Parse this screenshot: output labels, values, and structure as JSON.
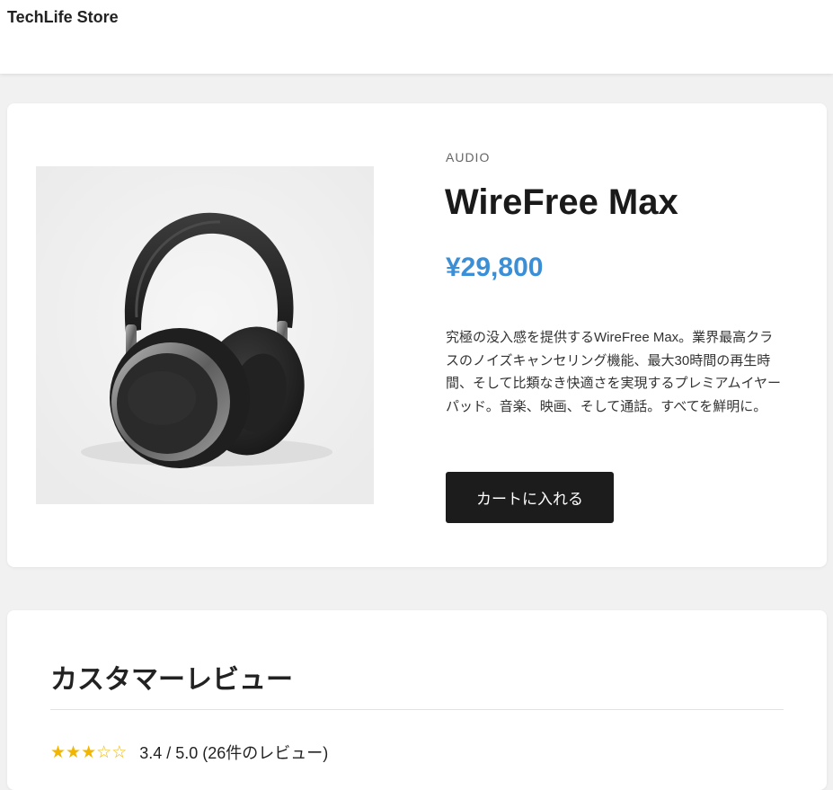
{
  "header": {
    "brand": "TechLife Store"
  },
  "product": {
    "category": "AUDIO",
    "name": "WireFree Max",
    "price": "¥29,800",
    "description": "究極の没入感を提供するWireFree Max。業界最高クラスのノイズキャンセリング機能、最大30時間の再生時間、そして比類なき快適さを実現するプレミアムイヤーパッド。音楽、映画、そして通話。すべてを鮮明に。",
    "cart_button_label": "カートに入れる",
    "image_icon": "headphones-image"
  },
  "reviews": {
    "title": "カスタマーレビュー",
    "rating": 3.4,
    "rating_text": "3.4 / 5.0 (26件のレビュー)",
    "stars": [
      "★",
      "★",
      "★",
      "☆",
      "☆"
    ]
  },
  "colors": {
    "price": "#3a8fd6",
    "button": "#1c1c1c",
    "star": "#f2b600",
    "background": "#f1f1f1"
  }
}
